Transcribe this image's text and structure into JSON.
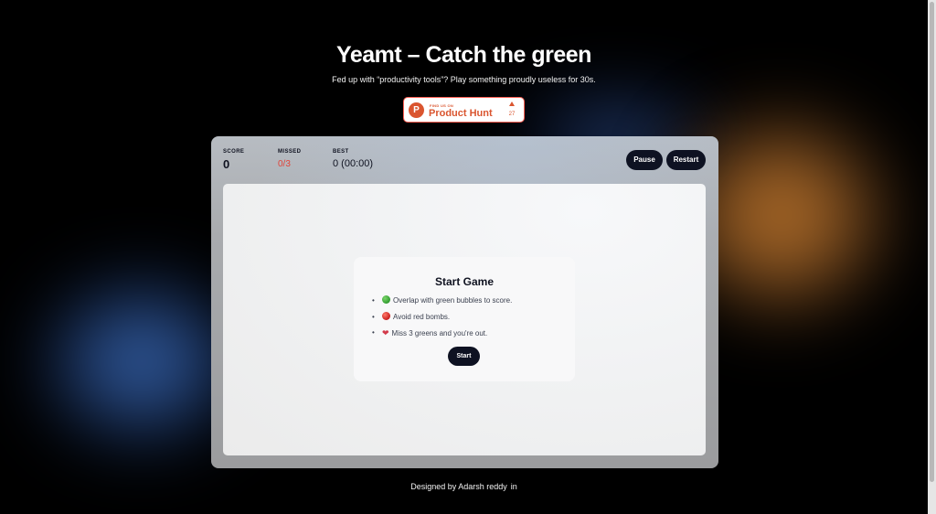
{
  "header": {
    "title": "Yeamt – Catch the green",
    "subtitle": "Fed up with “productivity tools”? Play something proudly useless for 30s."
  },
  "product_hunt": {
    "small_text": "FIND US ON",
    "name": "Product Hunt",
    "count": "27",
    "logo_letter": "P"
  },
  "stats": {
    "score_label": "SCORE",
    "score_value": "0",
    "missed_label": "MISSED",
    "missed_value": "0/3",
    "best_label": "BEST",
    "best_value": "0 (00:00)"
  },
  "controls": {
    "pause_label": "Pause",
    "restart_label": "Restart"
  },
  "start_card": {
    "title": "Start Game",
    "rules": [
      {
        "icon": "green-bubble-icon",
        "text": "Overlap with green bubbles to score."
      },
      {
        "icon": "red-bomb-icon",
        "text": "Avoid red bombs."
      },
      {
        "icon": "broken-heart-icon",
        "text": "Miss 3 greens and you're out."
      }
    ],
    "start_label": "Start"
  },
  "footer": {
    "text": "Designed by Adarsh reddy",
    "icon": "linkedin-icon"
  },
  "colors": {
    "background": "#000000",
    "button": "#0e1222",
    "missed": "#e0443a",
    "product_hunt": "#da552f"
  }
}
